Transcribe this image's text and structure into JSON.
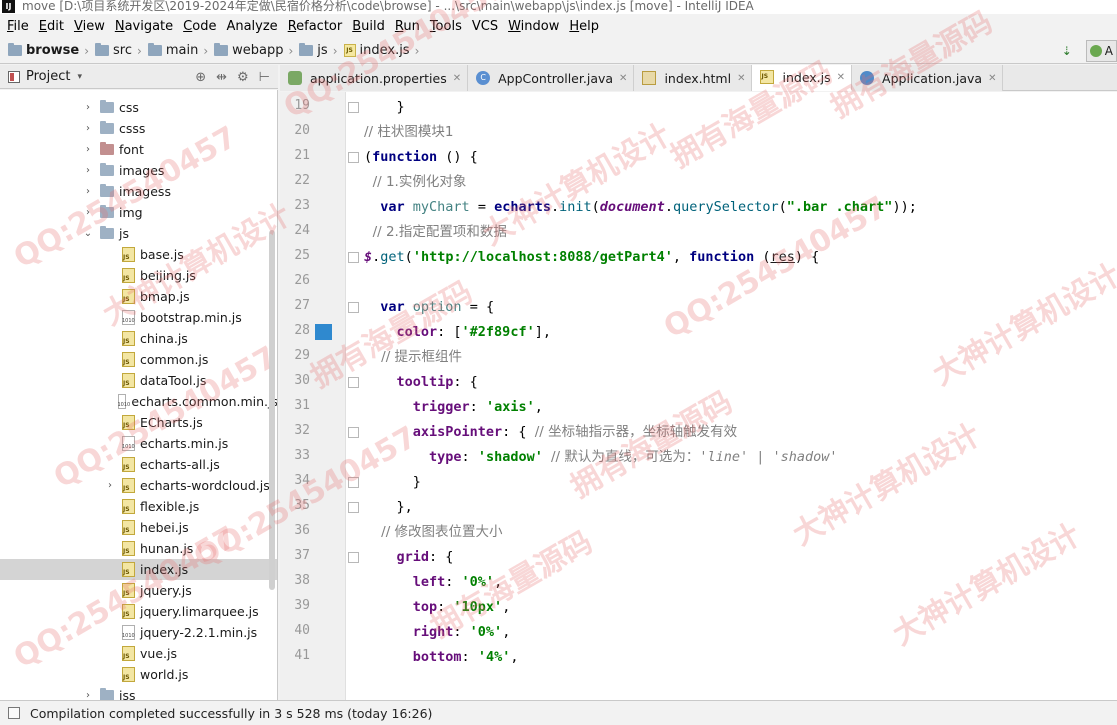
{
  "titlebar": {
    "title": "move [D:\\项目系统开发区\\2019-2024年定做\\民宿价格分析\\code\\browse] - ...\\src\\main\\webapp\\js\\index.js [move] - IntelliJ IDEA"
  },
  "menu": [
    {
      "label": "File",
      "mn": "F",
      "rest": "ile"
    },
    {
      "label": "Edit",
      "mn": "E",
      "rest": "dit"
    },
    {
      "label": "View",
      "mn": "V",
      "rest": "iew"
    },
    {
      "label": "Navigate",
      "mn": "N",
      "rest": "avigate"
    },
    {
      "label": "Code",
      "mn": "C",
      "rest": "ode"
    },
    {
      "label": "Analyze",
      "mn": "",
      "rest": "Analyze"
    },
    {
      "label": "Refactor",
      "mn": "R",
      "rest": "efactor"
    },
    {
      "label": "Build",
      "mn": "B",
      "rest": "uild"
    },
    {
      "label": "Run",
      "mn": "R",
      "rest": "un"
    },
    {
      "label": "Tools",
      "mn": "T",
      "rest": "ools"
    },
    {
      "label": "VCS",
      "mn": "",
      "rest": "VCS"
    },
    {
      "label": "Window",
      "mn": "W",
      "rest": "indow"
    },
    {
      "label": "Help",
      "mn": "H",
      "rest": "elp"
    }
  ],
  "breadcrumb": [
    {
      "label": "browse",
      "icon": "folder-icon",
      "bold": true
    },
    {
      "label": "src",
      "icon": "folder-icon"
    },
    {
      "label": "main",
      "icon": "folder-icon"
    },
    {
      "label": "webapp",
      "icon": "folder-icon"
    },
    {
      "label": "js",
      "icon": "folder-icon"
    },
    {
      "label": "index.js",
      "icon": "js-file-icon"
    }
  ],
  "nav_right": {
    "run_label": "A"
  },
  "project_panel": {
    "title": "Project"
  },
  "tree": [
    {
      "label": "css",
      "type": "folder",
      "arrow": "›",
      "indent": 1
    },
    {
      "label": "csss",
      "type": "folder",
      "arrow": "›",
      "indent": 1
    },
    {
      "label": "font",
      "type": "folder-red",
      "arrow": "›",
      "indent": 1
    },
    {
      "label": "images",
      "type": "folder",
      "arrow": "›",
      "indent": 1
    },
    {
      "label": "imagess",
      "type": "folder",
      "arrow": "›",
      "indent": 1
    },
    {
      "label": "img",
      "type": "folder",
      "arrow": "›",
      "indent": 1
    },
    {
      "label": "js",
      "type": "folder",
      "arrow": "⌄",
      "indent": 1
    },
    {
      "label": "base.js",
      "type": "js",
      "indent": 2
    },
    {
      "label": "beijing.js",
      "type": "js",
      "indent": 2
    },
    {
      "label": "bmap.js",
      "type": "js",
      "indent": 2
    },
    {
      "label": "bootstrap.min.js",
      "type": "minjs",
      "indent": 2
    },
    {
      "label": "china.js",
      "type": "js",
      "indent": 2
    },
    {
      "label": "common.js",
      "type": "js",
      "indent": 2
    },
    {
      "label": "dataTool.js",
      "type": "js",
      "indent": 2
    },
    {
      "label": "echarts.common.min.js",
      "type": "minjs",
      "indent": 2
    },
    {
      "label": "ECharts.js",
      "type": "js",
      "indent": 2
    },
    {
      "label": "echarts.min.js",
      "type": "minjs",
      "indent": 2
    },
    {
      "label": "echarts-all.js",
      "type": "js",
      "indent": 2
    },
    {
      "label": "echarts-wordcloud.js",
      "type": "js",
      "arrow": "›",
      "indent": 2
    },
    {
      "label": "flexible.js",
      "type": "js",
      "indent": 2
    },
    {
      "label": "hebei.js",
      "type": "js",
      "indent": 2
    },
    {
      "label": "hunan.js",
      "type": "js",
      "indent": 2
    },
    {
      "label": "index.js",
      "type": "js",
      "indent": 2,
      "selected": true
    },
    {
      "label": "jquery.js",
      "type": "js",
      "indent": 2
    },
    {
      "label": "jquery.limarquee.js",
      "type": "js",
      "indent": 2
    },
    {
      "label": "jquery-2.2.1.min.js",
      "type": "minjs",
      "indent": 2
    },
    {
      "label": "vue.js",
      "type": "js",
      "indent": 2
    },
    {
      "label": "world.js",
      "type": "js",
      "indent": 2
    },
    {
      "label": "jss",
      "type": "folder",
      "arrow": "›",
      "indent": 1
    }
  ],
  "tabs": [
    {
      "label": "application.properties",
      "icon": "props",
      "glyph": ""
    },
    {
      "label": "AppController.java",
      "icon": "cls",
      "glyph": "C"
    },
    {
      "label": "index.html",
      "icon": "html",
      "glyph": ""
    },
    {
      "label": "index.js",
      "icon": "js",
      "glyph": "JS",
      "active": true
    },
    {
      "label": "Application.java",
      "icon": "app",
      "glyph": ""
    }
  ],
  "editor": {
    "first_line": 19,
    "lines": [
      [
        [
          "plain",
          "    }"
        ]
      ],
      [
        [
          "com",
          "// 柱状图模块1"
        ]
      ],
      [
        [
          "plain",
          "("
        ],
        [
          "kw",
          "function"
        ],
        [
          "plain",
          " () {"
        ]
      ],
      [
        [
          "com",
          "  // 1.实例化对象"
        ]
      ],
      [
        [
          "kw",
          "  var "
        ],
        [
          "var",
          "myChart"
        ],
        [
          "plain",
          " = "
        ],
        [
          "kw",
          "echarts"
        ],
        [
          "plain",
          "."
        ],
        [
          "fn",
          "init"
        ],
        [
          "plain",
          "("
        ],
        [
          "dom",
          "document"
        ],
        [
          "plain",
          "."
        ],
        [
          "fn",
          "querySelector"
        ],
        [
          "plain",
          "("
        ],
        [
          "str",
          "\".bar .chart\""
        ],
        [
          "plain",
          "));"
        ]
      ],
      [
        [
          "com",
          "  // 2.指定配置项和数据"
        ]
      ],
      [
        [
          "dom",
          "$"
        ],
        [
          "plain",
          "."
        ],
        [
          "fn",
          "get"
        ],
        [
          "plain",
          "("
        ],
        [
          "str",
          "'http://localhost:8088/getPart4'"
        ],
        [
          "plain",
          ", "
        ],
        [
          "kw",
          "function"
        ],
        [
          "plain",
          " ("
        ],
        [
          "ul",
          "res"
        ],
        [
          "plain",
          ") {"
        ]
      ],
      [
        [
          "plain",
          ""
        ]
      ],
      [
        [
          "kw",
          "  var "
        ],
        [
          "var",
          "option"
        ],
        [
          "plain",
          " = {"
        ]
      ],
      [
        [
          "prop",
          "    color"
        ],
        [
          "plain",
          ": ["
        ],
        [
          "str",
          "'#2f89cf'"
        ],
        [
          "plain",
          "],"
        ]
      ],
      [
        [
          "com",
          "    // 提示框组件"
        ]
      ],
      [
        [
          "prop",
          "    tooltip"
        ],
        [
          "plain",
          ": {"
        ]
      ],
      [
        [
          "prop",
          "      trigger"
        ],
        [
          "plain",
          ": "
        ],
        [
          "str",
          "'axis'"
        ],
        [
          "plain",
          ","
        ]
      ],
      [
        [
          "prop",
          "      axisPointer"
        ],
        [
          "plain",
          ": { "
        ],
        [
          "com",
          "// 坐标轴指示器，坐标轴触发有效"
        ]
      ],
      [
        [
          "prop",
          "        type"
        ],
        [
          "plain",
          ": "
        ],
        [
          "str",
          "'shadow'"
        ],
        [
          "plain",
          " "
        ],
        [
          "com",
          "// 默认为直线，可选为："
        ],
        [
          "comi",
          "'line' | 'shadow'"
        ]
      ],
      [
        [
          "plain",
          "      }"
        ]
      ],
      [
        [
          "plain",
          "    },"
        ]
      ],
      [
        [
          "com",
          "    // 修改图表位置大小"
        ]
      ],
      [
        [
          "prop",
          "    grid"
        ],
        [
          "plain",
          ": {"
        ]
      ],
      [
        [
          "prop",
          "      left"
        ],
        [
          "plain",
          ": "
        ],
        [
          "str",
          "'0%'"
        ],
        [
          "plain",
          ","
        ]
      ],
      [
        [
          "prop",
          "      top"
        ],
        [
          "plain",
          ": "
        ],
        [
          "str",
          "'10px'"
        ],
        [
          "plain",
          ","
        ]
      ],
      [
        [
          "prop",
          "      right"
        ],
        [
          "plain",
          ": "
        ],
        [
          "str",
          "'0%'"
        ],
        [
          "plain",
          ","
        ]
      ],
      [
        [
          "prop",
          "      bottom"
        ],
        [
          "plain",
          ": "
        ],
        [
          "str",
          "'4%'"
        ],
        [
          "plain",
          ","
        ]
      ]
    ],
    "fold_lines": [
      19,
      21,
      25,
      27,
      30,
      32,
      34,
      35,
      37
    ],
    "bookmark_line": 28,
    "bookmark_color": "#2f89cf"
  },
  "status": {
    "message": "Compilation completed successfully in 3 s 528 ms (today 16:26)"
  },
  "watermark": {
    "texts": [
      "QQ:254540457",
      "拥有海量源码",
      "大神计算机设计",
      "QQ:254540457",
      "拥有海量源码",
      "大神计算机设计",
      "QQ:254540457",
      "拥有海量源码",
      "大神计算机设计",
      "QQ:254540457",
      "拥有海量源码",
      "大神计算机设计",
      "QQ:254540457",
      "拥有海量源码",
      "大神计算机设计",
      "QQ:254540457"
    ],
    "color": "#e66e6e"
  }
}
